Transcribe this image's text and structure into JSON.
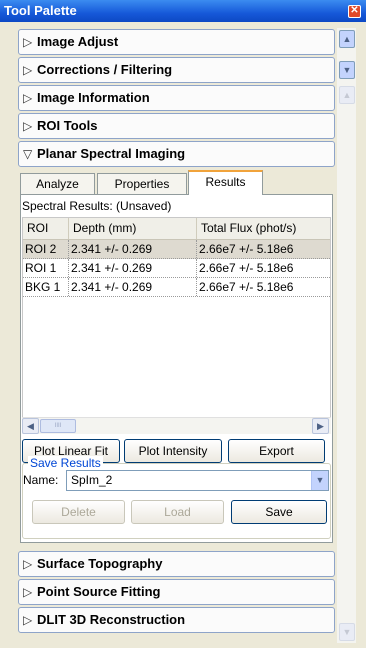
{
  "window": {
    "title": "Tool Palette",
    "close_glyph": "✕"
  },
  "sections_top": [
    {
      "label": "Image Adjust",
      "icon": "triangle-right-icon"
    },
    {
      "label": "Corrections / Filtering",
      "icon": "triangle-right-icon"
    },
    {
      "label": "Image Information",
      "icon": "triangle-right-icon"
    },
    {
      "label": "ROI Tools",
      "icon": "triangle-right-icon"
    },
    {
      "label": "Planar Spectral Imaging",
      "icon": "triangle-down-icon",
      "expanded": true
    }
  ],
  "tabs": [
    {
      "label": "Analyze"
    },
    {
      "label": "Properties"
    },
    {
      "label": "Results",
      "active": true
    }
  ],
  "results": {
    "title": "Spectral Results: (Unsaved)",
    "columns": [
      "ROI",
      "Depth (mm)",
      "Total Flux (phot/s)"
    ],
    "rows": [
      {
        "roi": "ROI 2",
        "depth": "2.341 +/- 0.269",
        "flux": "2.66e7 +/- 5.18e6",
        "selected": true
      },
      {
        "roi": "ROI 1",
        "depth": "2.341 +/- 0.269",
        "flux": "2.66e7 +/- 5.18e6"
      },
      {
        "roi": "BKG 1",
        "depth": "2.341 +/- 0.269",
        "flux": "2.66e7 +/- 5.18e6"
      }
    ]
  },
  "actions": {
    "plot_linear_fit": "Plot Linear Fit",
    "plot_intensity": "Plot Intensity",
    "export": "Export"
  },
  "save_results": {
    "legend": "Save Results",
    "name_label": "Name:",
    "name_value": "SpIm_2",
    "delete": "Delete",
    "load": "Load",
    "save": "Save"
  },
  "sections_bottom": [
    {
      "label": "Surface Topography",
      "icon": "triangle-right-icon"
    },
    {
      "label": "Point Source Fitting",
      "icon": "triangle-right-icon"
    },
    {
      "label": "DLIT 3D Reconstruction",
      "icon": "triangle-right-icon"
    }
  ],
  "glyphs": {
    "right": "▷",
    "down": "▽",
    "left_arrow": "◀",
    "right_arrow": "▶",
    "up_arrow": "▲",
    "down_arrow": "▼",
    "thumb": "IIII"
  },
  "colors": {
    "title_bar": "#1659d9",
    "tab_accent": "#f1a33b",
    "legend_text": "#0046d5",
    "close_button": "#e04a2a"
  }
}
